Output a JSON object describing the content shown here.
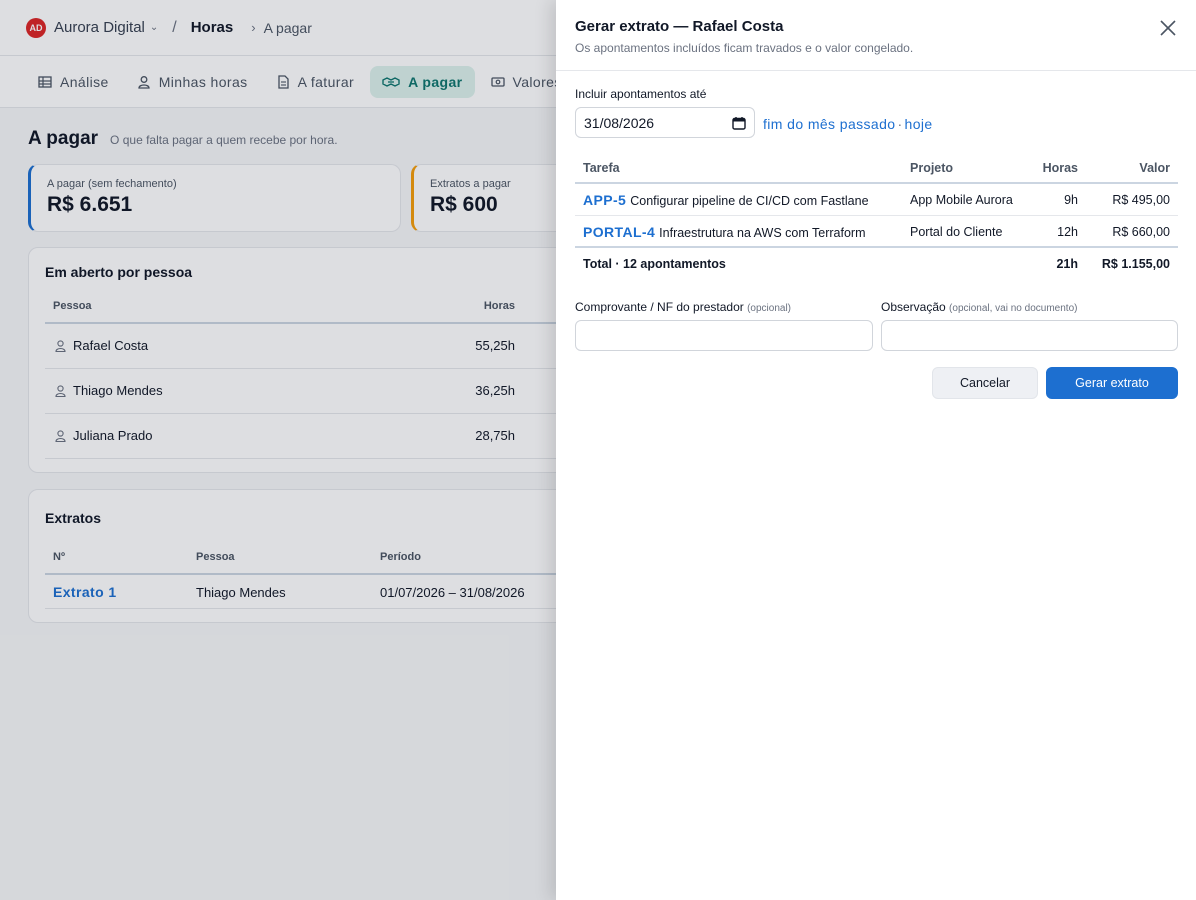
{
  "header": {
    "logo_text": "AD",
    "org_name": "Aurora Digital",
    "section": "Horas",
    "breadcrumb_current": "A pagar"
  },
  "tabs": [
    {
      "label": "Análise",
      "icon": "table-icon"
    },
    {
      "label": "Minhas horas",
      "icon": "person-icon"
    },
    {
      "label": "A faturar",
      "icon": "document-icon"
    },
    {
      "label": "A pagar",
      "icon": "handshake-icon",
      "active": true
    },
    {
      "label": "Valores",
      "icon": "cash-icon"
    }
  ],
  "page": {
    "title": "A pagar",
    "subtitle": "O que falta pagar a quem recebe por hora."
  },
  "stats": [
    {
      "label": "A pagar (sem fechamento)",
      "value": "R$ 6.651",
      "accent": "#1d6fd0"
    },
    {
      "label": "Extratos a pagar",
      "value": "R$ 600",
      "accent": "#f59e0b"
    }
  ],
  "open_by_person": {
    "title": "Em aberto por pessoa",
    "headers": {
      "person": "Pessoa",
      "hours": "Horas"
    },
    "rows": [
      {
        "name": "Rafael Costa",
        "hours": "55,25h"
      },
      {
        "name": "Thiago Mendes",
        "hours": "36,25h"
      },
      {
        "name": "Juliana Prado",
        "hours": "28,75h"
      }
    ]
  },
  "statements": {
    "title": "Extratos",
    "headers": {
      "number": "Nº",
      "person": "Pessoa",
      "period": "Período"
    },
    "rows": [
      {
        "number": "Extrato 1",
        "person": "Thiago Mendes",
        "period": "01/07/2026 – 31/08/2026"
      }
    ]
  },
  "drawer": {
    "title": "Gerar extrato — Rafael Costa",
    "subtitle": "Os apontamentos incluídos ficam travados e o valor congelado.",
    "date_label": "Incluir apontamentos até",
    "date_value": "31/08/2026",
    "quick_links": [
      "fim do mês passado",
      "hoje"
    ],
    "quick_sep": "·",
    "table": {
      "headers": {
        "task": "Tarefa",
        "project": "Projeto",
        "hours": "Horas",
        "value": "Valor"
      },
      "rows": [
        {
          "key": "APP-5",
          "task": "Configurar pipeline de CI/CD com Fastlane",
          "project": "App Mobile Aurora",
          "hours": "9h",
          "value": "R$ 495,00"
        },
        {
          "key": "PORTAL-4",
          "task": "Infraestrutura na AWS com Terraform",
          "project": "Portal do Cliente",
          "hours": "12h",
          "value": "R$ 660,00"
        }
      ],
      "total": {
        "label": "Total · 12 apontamentos",
        "hours": "21h",
        "value": "R$ 1.155,00"
      }
    },
    "receipt": {
      "label": "Comprovante / NF do prestador",
      "hint": "(opcional)",
      "value": ""
    },
    "notes": {
      "label": "Observação",
      "hint": "(opcional, vai no documento)",
      "value": ""
    },
    "cancel_label": "Cancelar",
    "submit_label": "Gerar extrato",
    "accent": "#1d6fd0"
  }
}
